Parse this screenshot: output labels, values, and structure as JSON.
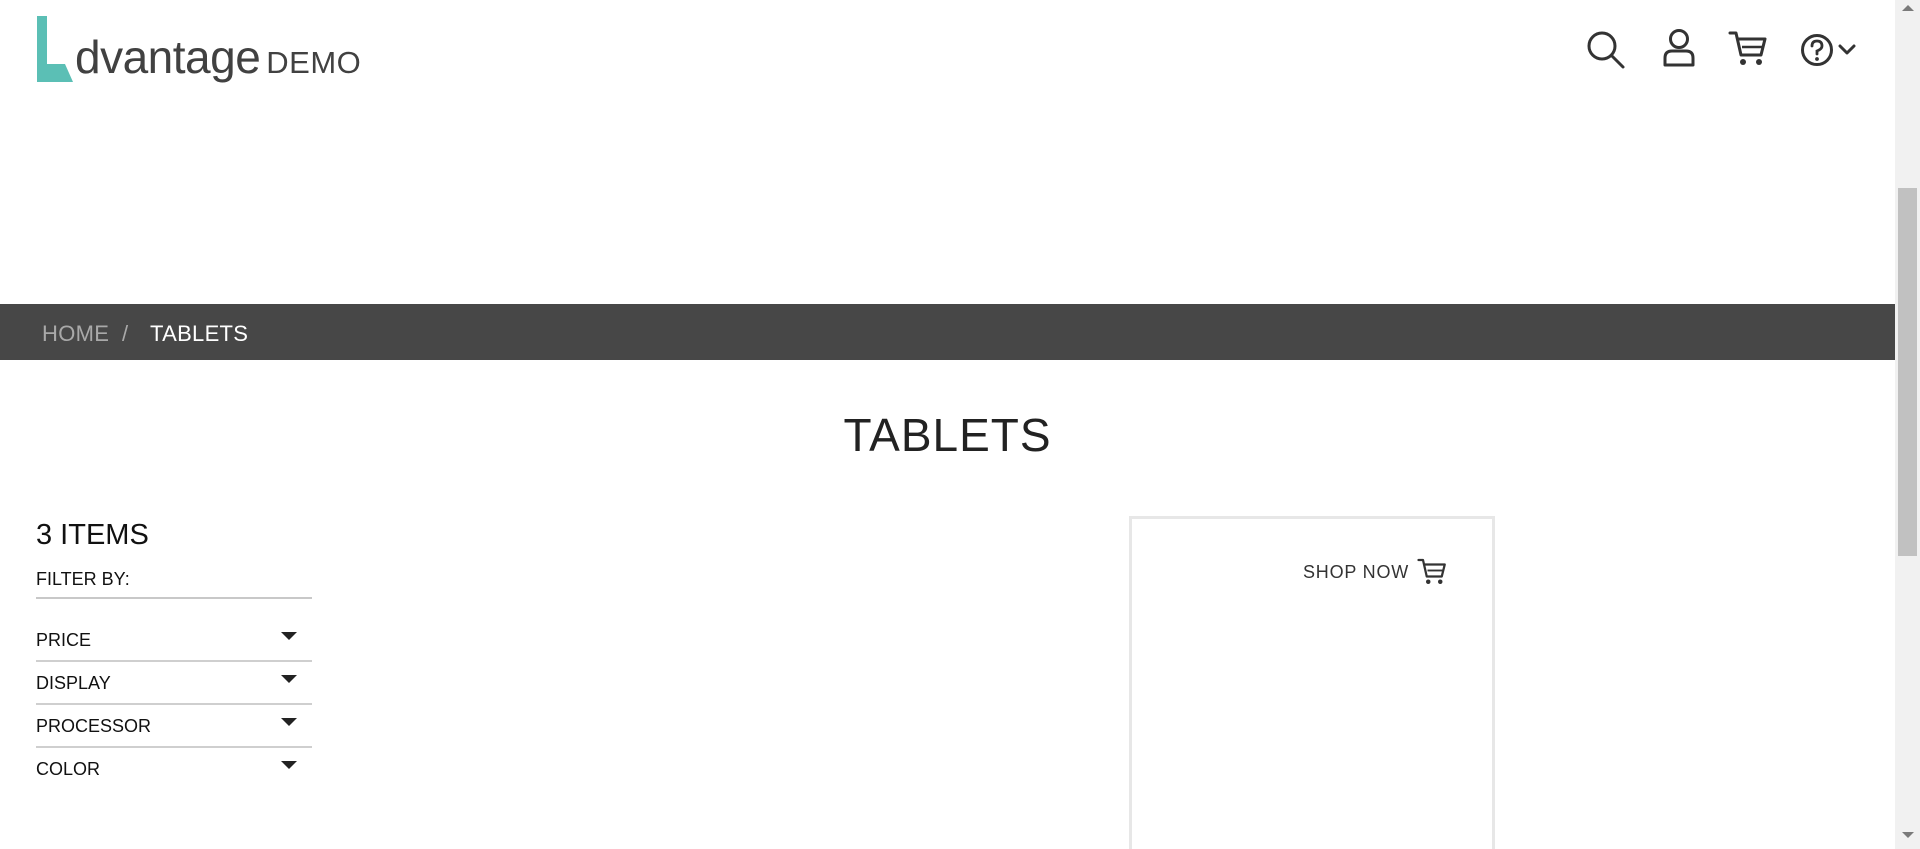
{
  "header": {
    "logo_text": "dvantage",
    "logo_suffix": "DEMO",
    "brand_color": "#5bbfb5",
    "icons": [
      "search-icon",
      "user-icon",
      "cart-icon",
      "help-icon",
      "chevron-down-icon"
    ]
  },
  "breadcrumb": {
    "home": "HOME",
    "separator": "/",
    "current": "TABLETS"
  },
  "main": {
    "title": "TABLETS"
  },
  "filters": {
    "items_count": "3 ITEMS",
    "filter_by": "FILTER BY:",
    "options": [
      {
        "label": "PRICE"
      },
      {
        "label": "DISPLAY"
      },
      {
        "label": "PROCESSOR"
      },
      {
        "label": "COLOR"
      }
    ]
  },
  "promo": {
    "shop_now": "SHOP NOW"
  }
}
